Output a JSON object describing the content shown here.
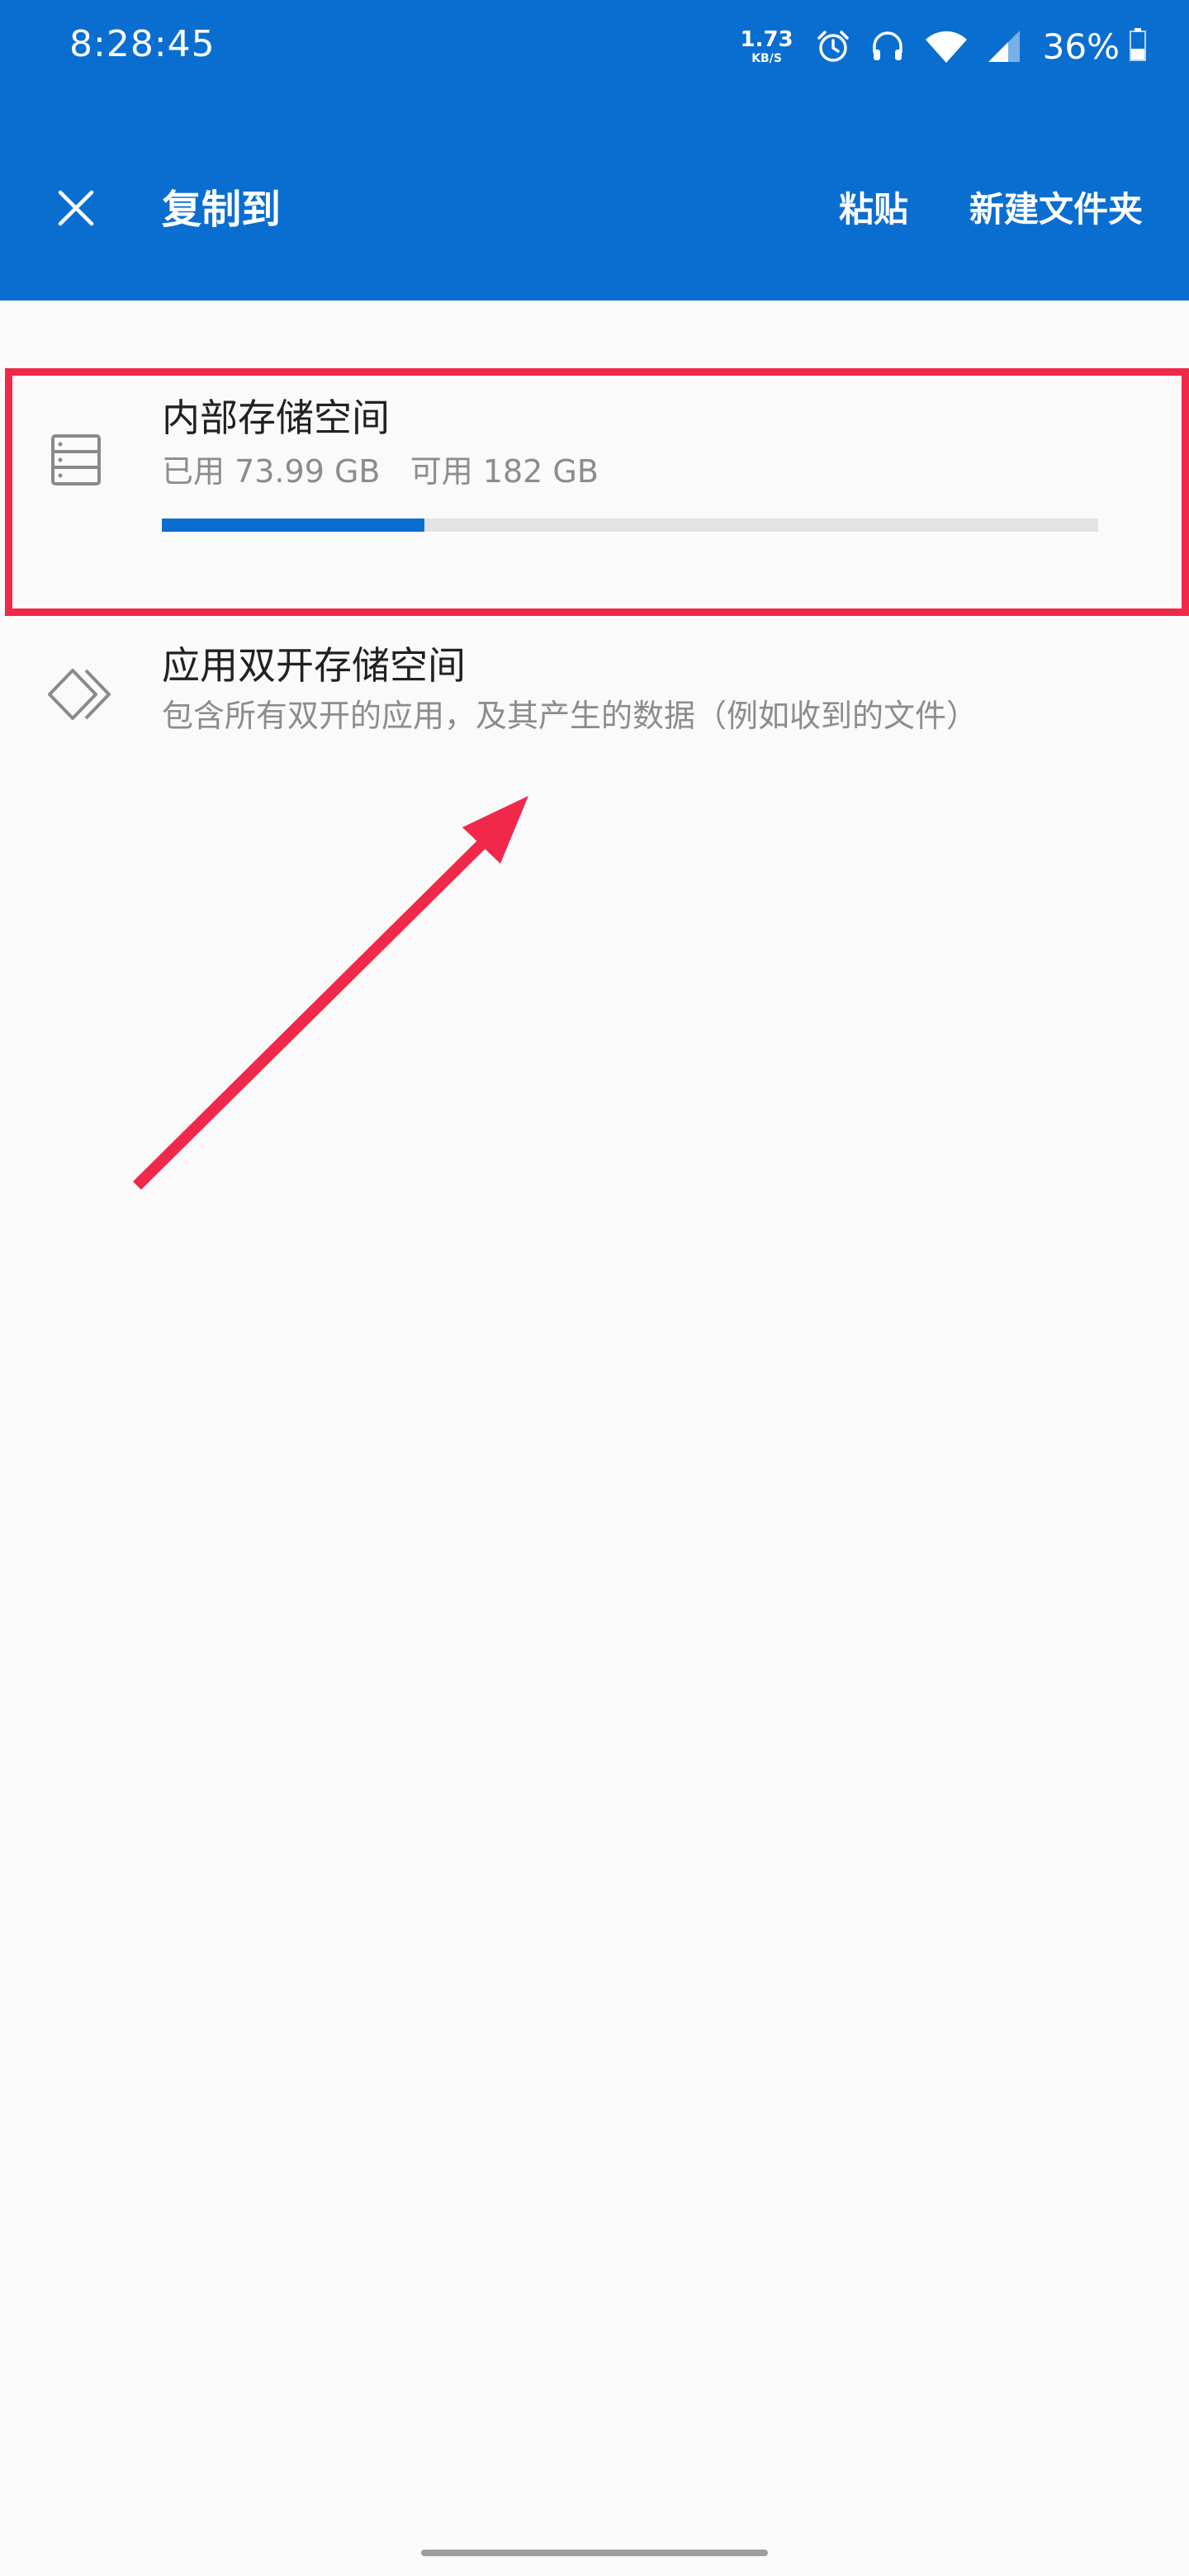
{
  "status_bar": {
    "time": "8:28:45",
    "net_speed_value": "1.73",
    "net_speed_unit": "KB/S",
    "battery_percent": "36%"
  },
  "toolbar": {
    "title": "复制到",
    "paste_label": "粘贴",
    "new_folder_label": "新建文件夹"
  },
  "storage": {
    "title": "内部存储空间",
    "usage_text": "已用 73.99 GB   可用 182 GB",
    "used_fraction": 0.28
  },
  "clone_storage": {
    "title": "应用双开存储空间",
    "subtitle": "包含所有双开的应用，及其产生的数据（例如收到的文件）"
  },
  "colors": {
    "primary": "#0a6ed1",
    "highlight": "#f0284a"
  },
  "icons": {
    "close": "close-icon",
    "storage": "storage-icon",
    "clone": "diamond-icon"
  }
}
